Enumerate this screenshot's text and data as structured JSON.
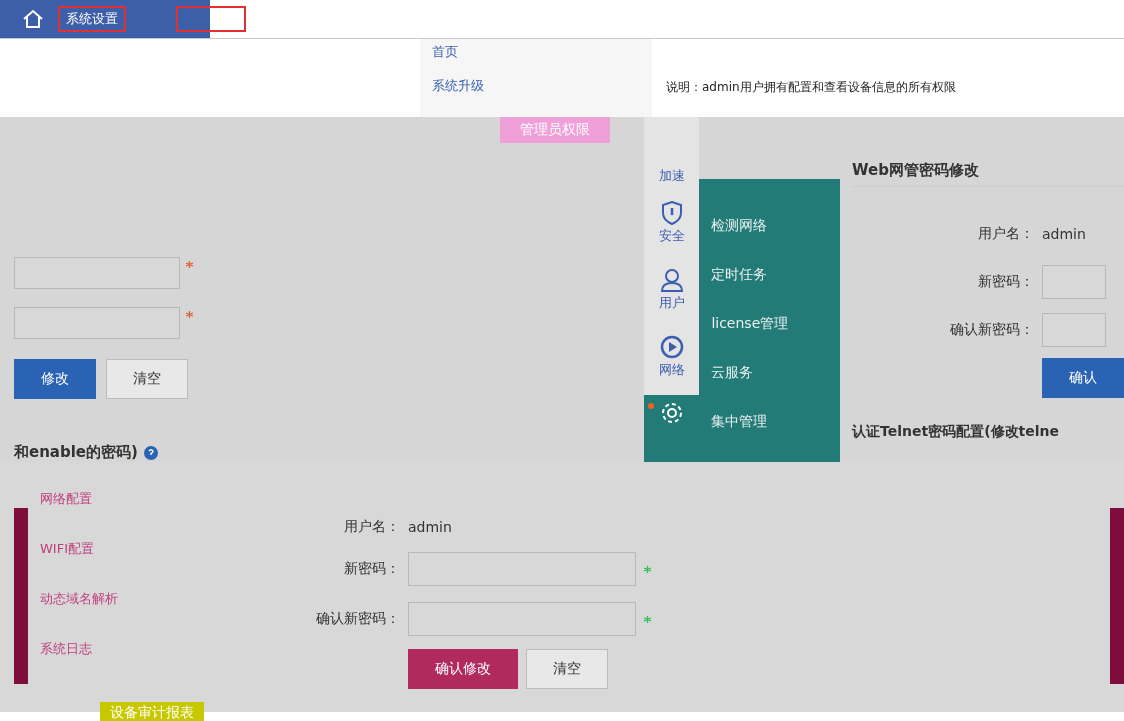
{
  "top_tabs": [
    {
      "label": "系统设置",
      "selected": true
    },
    {
      "selected": false
    }
  ],
  "quick_links": [
    {
      "label": "首页"
    },
    {
      "label": "系统升级"
    }
  ],
  "note": "说明：admin用户拥有配置和查看设备信息的所有权限",
  "admin_badge": "管理员权限",
  "left_form": {
    "buttons": [
      {
        "label": "修改",
        "kind": "primary"
      },
      {
        "label": "清空",
        "kind": "plain"
      }
    ],
    "section_title": "和enable的密码)"
  },
  "icon_rail": [
    {
      "label": "加速",
      "kind": "text",
      "selected": false
    },
    {
      "label": "安全",
      "kind": "security",
      "selected": false
    },
    {
      "label": "用户",
      "kind": "user",
      "selected": false
    },
    {
      "label": "网络",
      "kind": "network",
      "selected": false
    },
    {
      "kind": "settings",
      "selected": true
    }
  ],
  "flyout_menu": [
    "检测网络",
    "定时任务",
    "license管理",
    "云服务",
    "集中管理"
  ],
  "right_form": {
    "title": "Web网管密码修改",
    "username_label": "用户名：",
    "username": "admin",
    "new_label": "新密码：",
    "confirm_label": "确认新密码：",
    "button": "确认",
    "next_title": "认证Telnet密码配置(修改telne"
  },
  "bottom_menu": [
    "网络配置",
    "WIFI配置",
    "动态域名解析",
    "系统日志"
  ],
  "bottom_form": {
    "username_label": "用户名：",
    "username": "admin",
    "new_label": "新密码：",
    "confirm_label": "确认新密码：",
    "buttons": [
      {
        "label": "确认修改",
        "kind": "primary"
      },
      {
        "label": "清空",
        "kind": "plain"
      }
    ]
  },
  "report_label": "设备审计报表"
}
